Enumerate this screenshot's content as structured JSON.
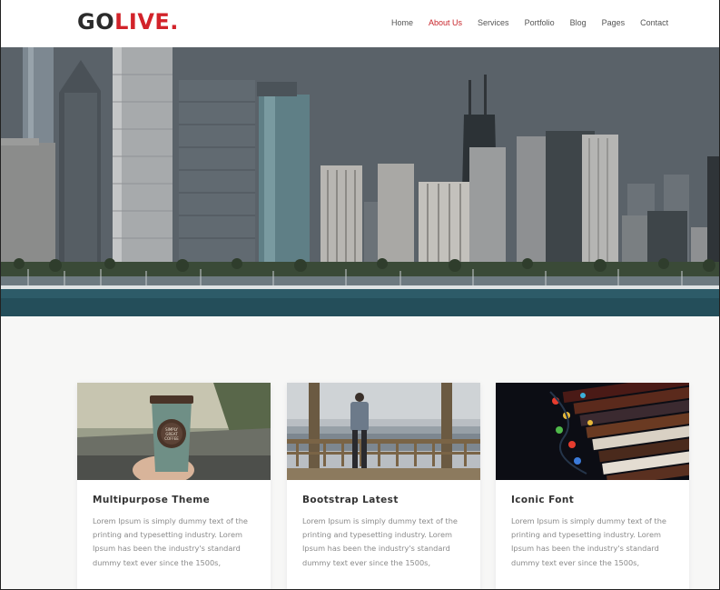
{
  "header": {
    "logo_part1": "GO",
    "logo_part2": "LIVE."
  },
  "nav": {
    "items": [
      {
        "label": "Home",
        "active": false
      },
      {
        "label": "About Us",
        "active": true
      },
      {
        "label": "Services",
        "active": false
      },
      {
        "label": "Portfolio",
        "active": false
      },
      {
        "label": "Blog",
        "active": false
      },
      {
        "label": "Pages",
        "active": false
      },
      {
        "label": "Contact",
        "active": false
      }
    ]
  },
  "colors": {
    "brand_red": "#d2232a",
    "logo_dark": "#2b2b2b",
    "nav_active": "#c8252b",
    "page_background": "#f7f7f6"
  },
  "hero": {
    "image": "city-skyline-waterfront"
  },
  "cards": [
    {
      "image": "coffee-cup-car",
      "title": "Multipurpose Theme",
      "text": "Lorem Ipsum is simply dummy text of the printing and typesetting industry. Lorem Ipsum has been the industry's standard dummy text ever since the 1500s,"
    },
    {
      "image": "man-on-pier",
      "title": "Bootstrap Latest",
      "text": "Lorem Ipsum is simply dummy text of the printing and typesetting industry. Lorem Ipsum has been the industry's standard dummy text ever since the 1500s,"
    },
    {
      "image": "book-spines-lights",
      "title": "Iconic Font",
      "text": "Lorem Ipsum is simply dummy text of the printing and typesetting industry. Lorem Ipsum has been the industry's standard dummy text ever since the 1500s,"
    }
  ]
}
